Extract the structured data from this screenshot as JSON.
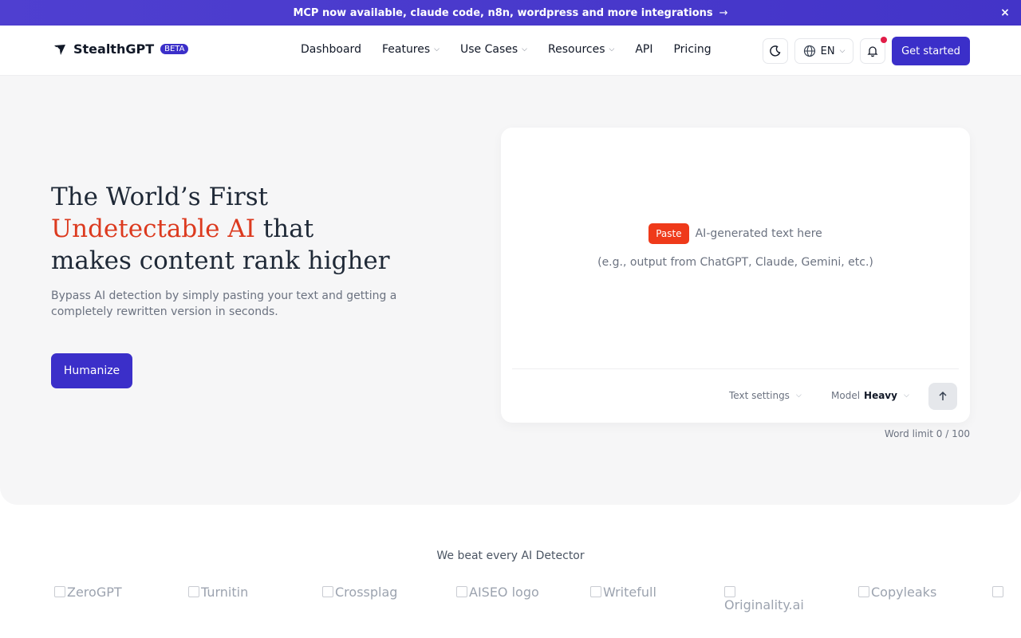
{
  "banner": {
    "text": "MCP now available, claude code, n8n, wordpress and more integrations",
    "arrow": "→",
    "close": "×"
  },
  "header": {
    "brand": "StealthGPT",
    "beta": "BETA",
    "nav": [
      {
        "label": "Dashboard",
        "dropdown": false
      },
      {
        "label": "Features",
        "dropdown": true
      },
      {
        "label": "Use Cases",
        "dropdown": true
      },
      {
        "label": "Resources",
        "dropdown": true
      },
      {
        "label": "API",
        "dropdown": false
      },
      {
        "label": "Pricing",
        "dropdown": false
      }
    ],
    "language": "EN",
    "cta": "Get started"
  },
  "hero": {
    "title_line1": "The World’s First",
    "title_accent": "Undetectable AI",
    "title_after_accent": " that",
    "title_line3": "makes content rank higher",
    "subtitle": "Bypass AI detection by simply pasting your text and getting a completely rewritten version in seconds.",
    "button": "Humanize"
  },
  "editor": {
    "paste_label": "Paste",
    "prompt": "AI-generated text here",
    "example": "(e.g., output from ChatGPT, Claude, Gemini, etc.)",
    "text_settings": "Text settings",
    "model_label": "Model",
    "model_value": "Heavy",
    "word_limit": "Word limit 0 / 100"
  },
  "detectors": {
    "heading": "We beat every AI Detector",
    "logos": [
      "ZeroGPT",
      "Turnitin",
      "Crossplag",
      "AISEO logo",
      "Writefull",
      "Originality.ai",
      "Copyleaks"
    ]
  },
  "colors": {
    "brand": "#3b2fc9",
    "accent": "#dc3a1f",
    "paste": "#ef3a1a",
    "notification": "#e11d48"
  }
}
